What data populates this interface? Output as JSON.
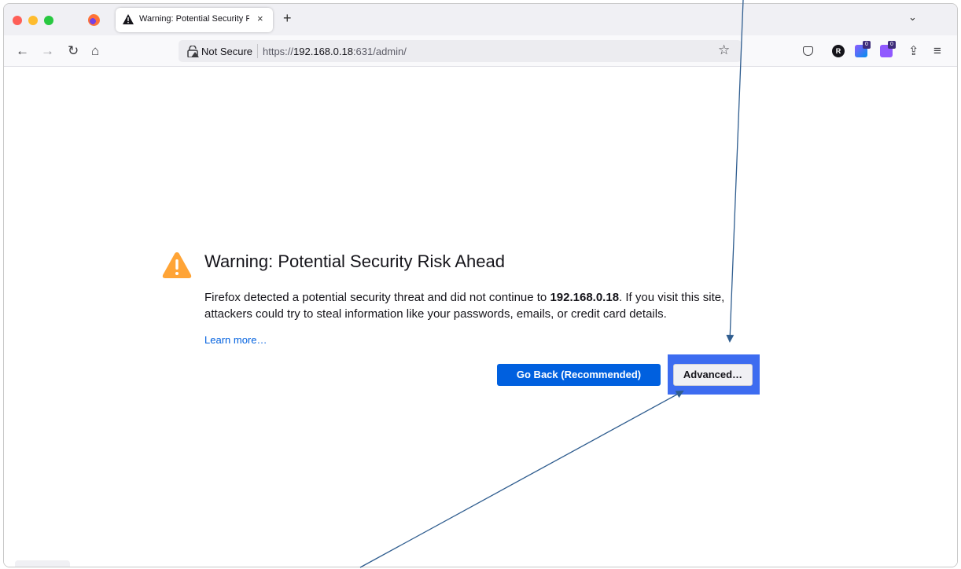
{
  "window": {
    "tab": {
      "title": "Warning: Potential Security Risk Ahead",
      "close_glyph": "×"
    },
    "new_tab_glyph": "+",
    "tab_list_glyph": "⌄"
  },
  "navbar": {
    "back_glyph": "←",
    "forward_glyph": "→",
    "reload_glyph": "↻",
    "home_glyph": "⌂",
    "security_label": "Not Secure",
    "url_prefix": "https://",
    "url_host": "192.168.0.18",
    "url_rest": ":631/admin/",
    "star_glyph": "☆",
    "ext_r_label": "R",
    "badge_blue": "0",
    "badge_purple": "0",
    "share_glyph": "⇪",
    "menu_glyph": "≡"
  },
  "page": {
    "heading": "Warning: Potential Security Risk Ahead",
    "desc_before": "Firefox detected a potential security threat and did not continue to ",
    "desc_host": "192.168.0.18",
    "desc_after": ". If you visit this site, attackers could try to steal information like your passwords, emails, or credit card details.",
    "learn_more": "Learn more…",
    "go_back_label": "Go Back (Recommended)",
    "advanced_label": "Advanced…"
  },
  "colors": {
    "accent": "#0060df",
    "highlight": "#3d6cf0",
    "warning": "#ffa436",
    "annotation_arrow": "#2f5d8f"
  },
  "icons": [
    "firefox-logo-icon",
    "warning-triangle-icon",
    "insecure-lock-icon",
    "bookmark-star-icon",
    "pocket-icon",
    "share-icon",
    "menu-icon"
  ]
}
